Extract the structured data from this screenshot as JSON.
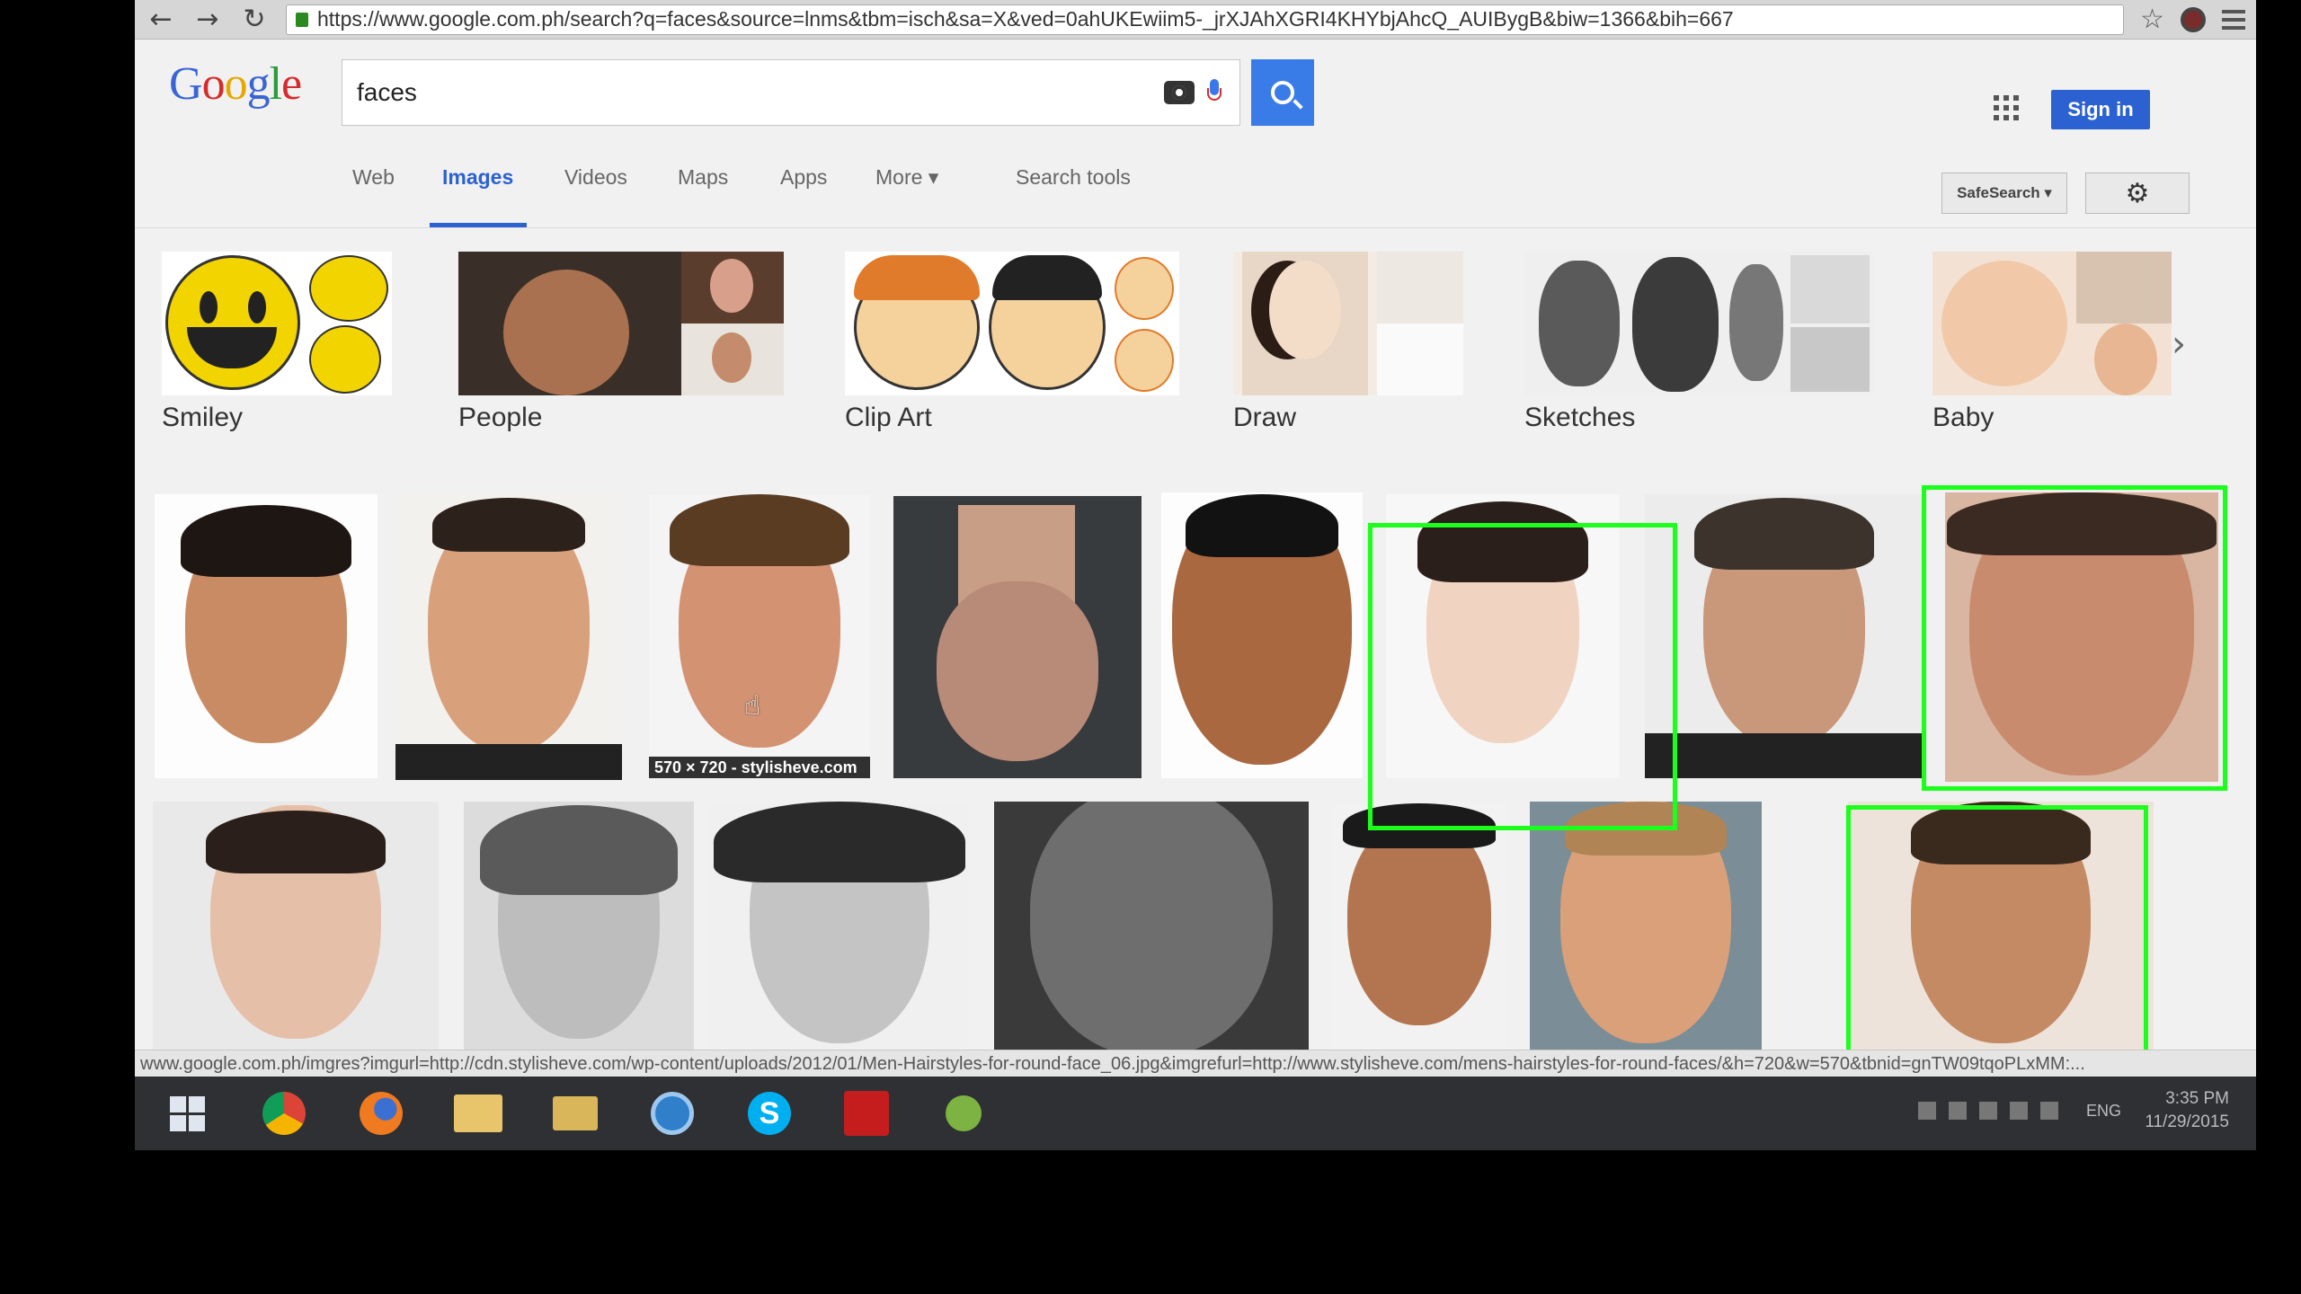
{
  "browser": {
    "url": "https://www.google.com.ph/search?q=faces&source=lnms&tbm=isch&sa=X&ved=0ahUKEwiim5-_jrXJAhXGRI4KHYbjAhcQ_AUIBygB&biw=1366&bih=667",
    "back_icon": "arrow-left-icon",
    "forward_icon": "arrow-right-icon",
    "reload_icon": "reload-icon"
  },
  "header": {
    "logo_letters": [
      "G",
      "o",
      "o",
      "g",
      "l",
      "e"
    ],
    "search_value": "faces",
    "sign_in_label": "Sign in"
  },
  "tabs": [
    {
      "label": "Web",
      "active": false
    },
    {
      "label": "Images",
      "active": true
    },
    {
      "label": "Videos",
      "active": false
    },
    {
      "label": "Maps",
      "active": false
    },
    {
      "label": "Apps",
      "active": false
    },
    {
      "label": "More ▾",
      "active": false
    },
    {
      "label": "Search tools",
      "active": false
    }
  ],
  "toolbar": {
    "safesearch_label": "SafeSearch ▾",
    "settings_icon": "gear-icon"
  },
  "related": [
    {
      "label": "Smiley"
    },
    {
      "label": "People"
    },
    {
      "label": "Clip Art"
    },
    {
      "label": "Draw"
    },
    {
      "label": "Sketches"
    },
    {
      "label": "Baby"
    }
  ],
  "results": {
    "hover_caption": "570 × 720 - stylisheve.com"
  },
  "status_bar": {
    "url": "www.google.com.ph/imgres?imgurl=http://cdn.stylisheve.com/wp-content/uploads/2012/01/Men-Hairstyles-for-round-face_06.jpg&imgrefurl=http://www.stylisheve.com/mens-hairstyles-for-round-faces/&h=720&w=570&tbnid=gnTW09tqoPLxMM:..."
  },
  "taskbar": {
    "lang": "ENG",
    "time": "3:35 PM",
    "date": "11/29/2015"
  },
  "colors": {
    "google_blue": "#3a66d4",
    "search_button": "#3a7ce7",
    "sign_in_button": "#2c61d1",
    "detection_box": "#1cff1c"
  }
}
